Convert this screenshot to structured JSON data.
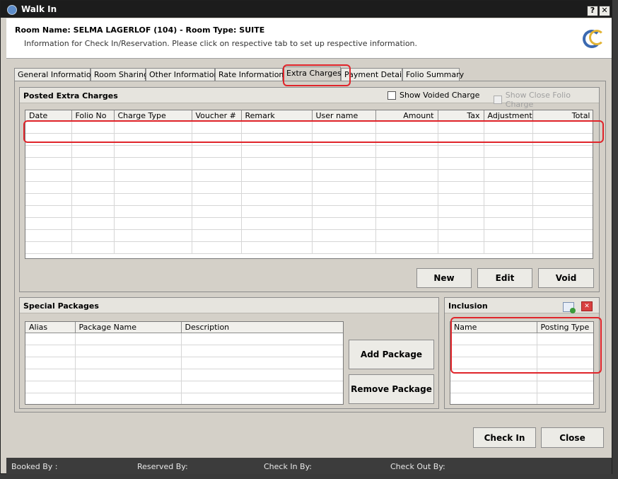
{
  "window": {
    "title": "Walk In",
    "help": "?",
    "close": "✕"
  },
  "header": {
    "room": "Room Name: SELMA LAGERLOF (104) - Room Type: SUITE",
    "info": "Information for Check In/Reservation. Please click on respective tab to set up respective information."
  },
  "tabs": [
    "General Information",
    "Room Sharing",
    "Other Information",
    "Rate Information",
    "Extra Charges",
    "Payment Details",
    "Folio Summary"
  ],
  "posted": {
    "title": "Posted Extra Charges",
    "show_voided": "Show Voided Charge",
    "show_close_folio": "Show Close Folio Charge",
    "columns": [
      "Date",
      "Folio No",
      "Charge Type",
      "Voucher #",
      "Remark",
      "User name",
      "Amount",
      "Tax",
      "Adjustment",
      "Total"
    ],
    "buttons": {
      "new": "New",
      "edit": "Edit",
      "void": "Void"
    }
  },
  "packages": {
    "title": "Special Packages",
    "columns": [
      "Alias",
      "Package Name",
      "Description"
    ],
    "add": "Add Package",
    "remove": "Remove Package"
  },
  "inclusion": {
    "title": "Inclusion",
    "columns": [
      "Name",
      "Posting Type"
    ]
  },
  "footer": {
    "check_in": "Check In",
    "close": "Close"
  },
  "status": {
    "booked_by": "Booked By :",
    "reserved_by": "Reserved By:",
    "check_in_by": "Check In By:",
    "check_out_by": "Check Out By:"
  },
  "colors": {
    "highlight": "#e0242a",
    "titlebar": "#1c1c1c"
  }
}
